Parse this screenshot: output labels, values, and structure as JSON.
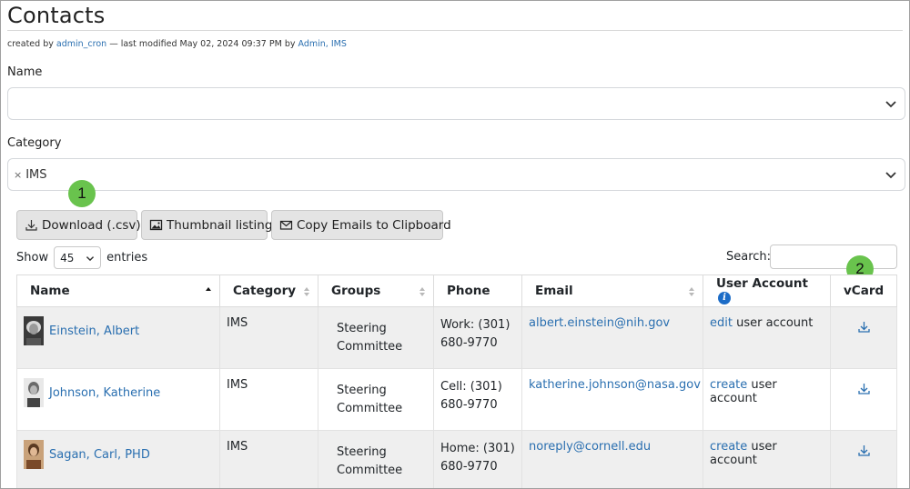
{
  "page": {
    "title": "Contacts"
  },
  "meta": {
    "created_prefix": "created by",
    "creator": "admin_cron",
    "modified_text": "— last modified May 02, 2024 09:37 PM by",
    "modifier": "Admin, IMS"
  },
  "filters": {
    "name_label": "Name",
    "category_label": "Category",
    "category_tag": "IMS",
    "tag_remove": "×"
  },
  "callouts": {
    "one": "1",
    "two": "2"
  },
  "toolbar": {
    "download_label": "Download (.csv)",
    "thumbnail_label": "Thumbnail listing",
    "copy_emails_label": "Copy Emails to Clipboard"
  },
  "length": {
    "show_label": "Show",
    "value": "45",
    "entries_label": "entries"
  },
  "search": {
    "label": "Search:"
  },
  "table": {
    "headers": [
      "Name",
      "Category",
      "Groups",
      "Phone",
      "Email",
      "User Account",
      "vCard"
    ],
    "rows": [
      {
        "name": "Einstein, Albert",
        "category": "IMS",
        "group_line1": "Steering",
        "group_line2": "Committee",
        "phone_line1": "Work: (301)",
        "phone_line2": "680-9770",
        "email": "albert.einstein@nih.gov",
        "account_link": "edit",
        "account_text": "user account"
      },
      {
        "name": "Johnson, Katherine",
        "category": "IMS",
        "group_line1": "Steering",
        "group_line2": "Committee",
        "phone_line1": "Cell: (301)",
        "phone_line2": "680-9770",
        "email": "katherine.johnson@nasa.gov",
        "account_link": "create",
        "account_text": "user account"
      },
      {
        "name": "Sagan, Carl, PHD",
        "category": "IMS",
        "group_line1": "Steering",
        "group_line2": "Committee",
        "phone_line1": "Home: (301)",
        "phone_line2": "680-9770",
        "email": "noreply@cornell.edu",
        "account_link": "create",
        "account_text": "user account"
      }
    ]
  },
  "icons": {
    "chevron": "chevron-down-icon",
    "download": "download-icon",
    "image": "image-icon",
    "envelope": "envelope-icon",
    "info": "info-icon",
    "info_glyph": "i"
  },
  "colors": {
    "link": "#2a6fb0",
    "callout": "#69c34d",
    "info": "#1c6cc7",
    "button_bg": "#e4e4e4",
    "row_stripe": "#efefef"
  }
}
